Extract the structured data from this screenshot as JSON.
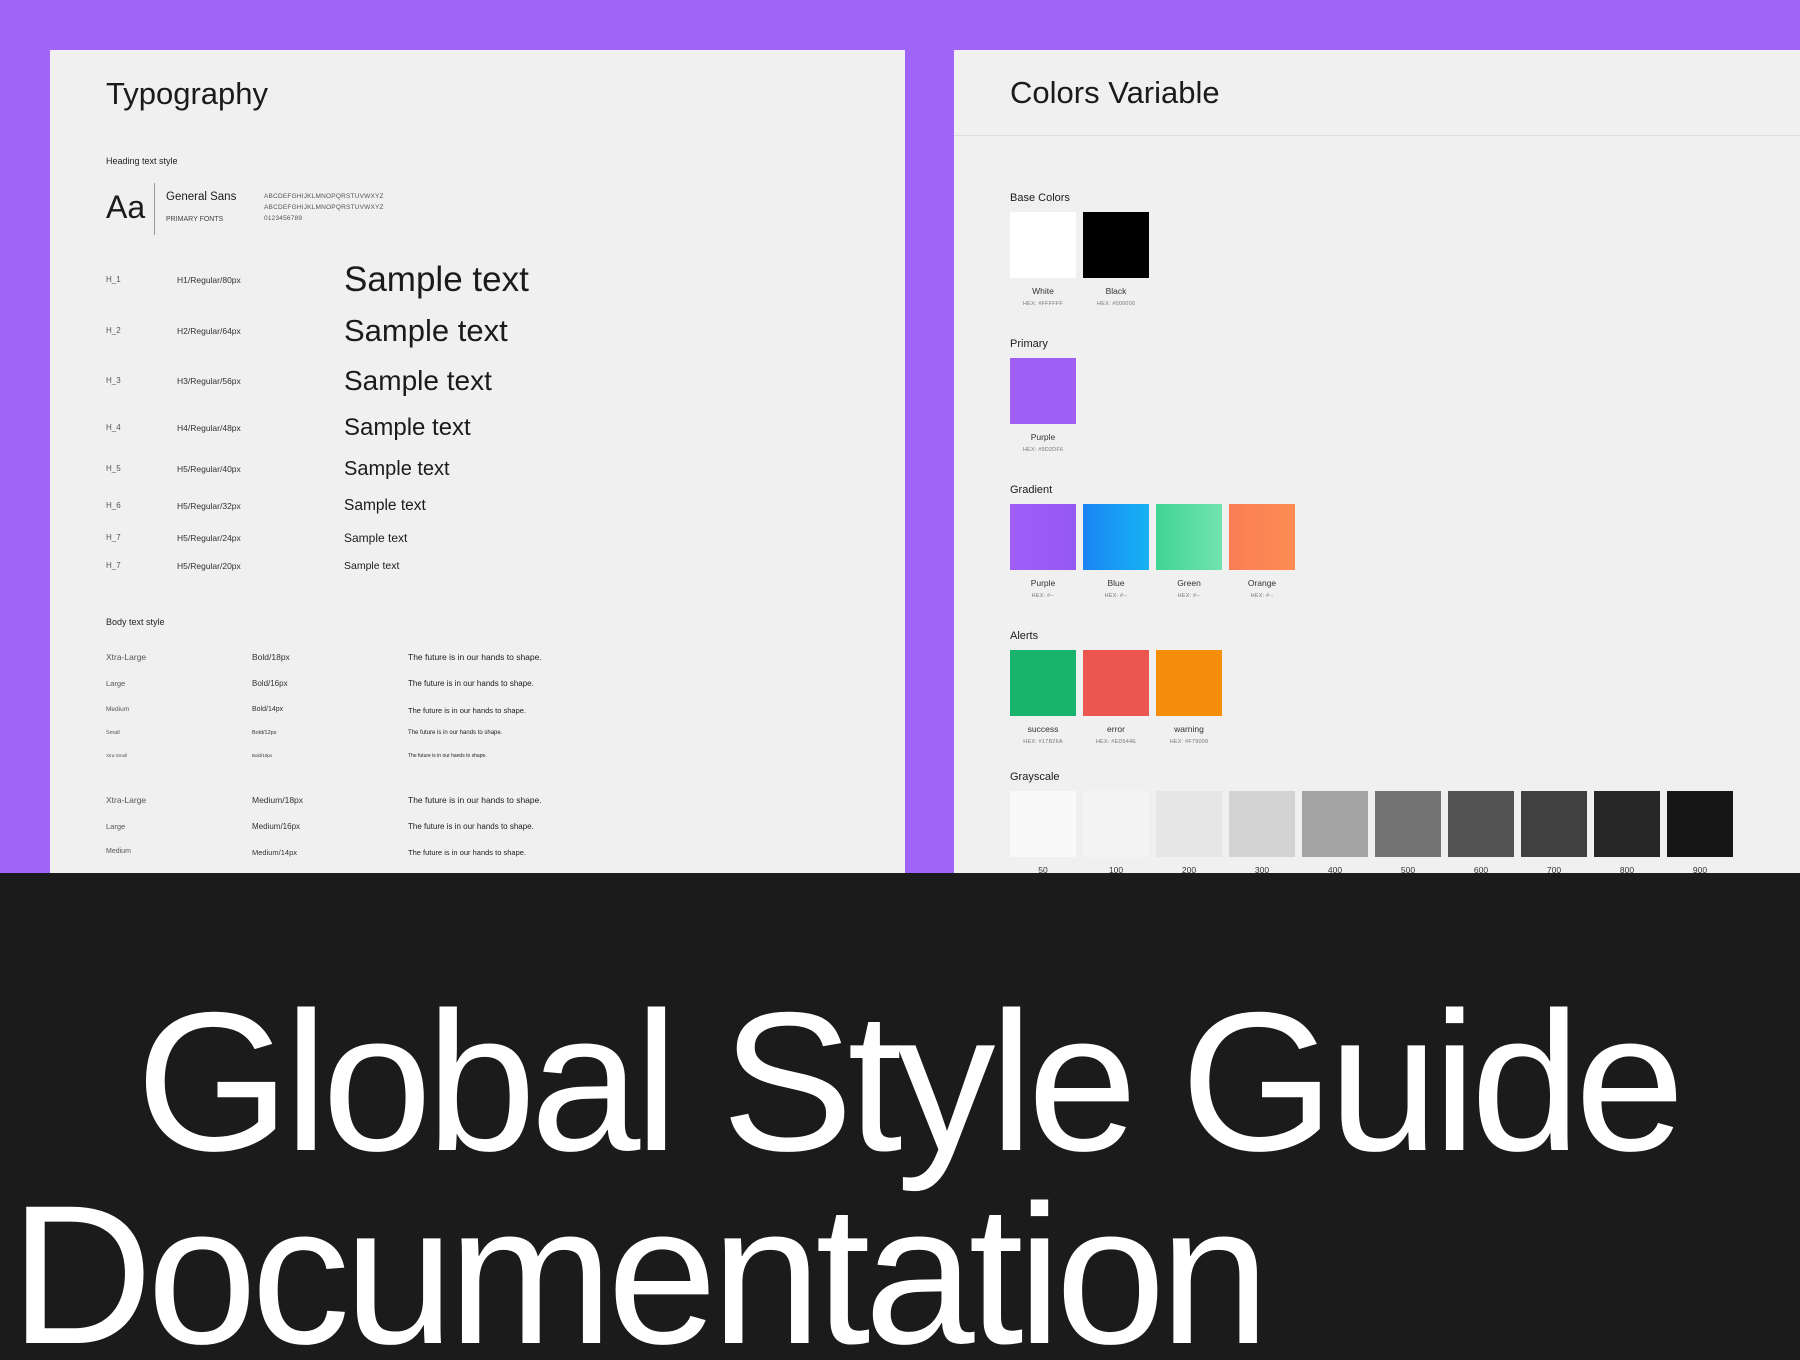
{
  "typography": {
    "title": "Typography",
    "heading_section_label": "Heading text style",
    "font_specimen": "Aa",
    "font_name": "General Sans",
    "font_role": "PRIMARY FONTS",
    "alphabet_upper": "ABCDEFGHIJKLMNOPQRSTUVWXYZ",
    "alphabet_lower": "ABCDEFGHIJKLMNOPQRSTUVWXYZ",
    "digits": "0123456789",
    "headings": [
      {
        "id": "H_1",
        "spec": "H1/Regular/80px",
        "sample": "Sample text"
      },
      {
        "id": "H_2",
        "spec": "H2/Regular/64px",
        "sample": "Sample text"
      },
      {
        "id": "H_3",
        "spec": "H3/Regular/56px",
        "sample": "Sample text"
      },
      {
        "id": "H_4",
        "spec": "H4/Regular/48px",
        "sample": "Sample text"
      },
      {
        "id": "H_5",
        "spec": "H5/Regular/40px",
        "sample": "Sample text"
      },
      {
        "id": "H_6",
        "spec": "H5/Regular/32px",
        "sample": "Sample text"
      },
      {
        "id": "H_7",
        "spec": "H5/Regular/24px",
        "sample": "Sample text"
      },
      {
        "id": "H_7",
        "spec": "H5/Regular/20px",
        "sample": "Sample text"
      }
    ],
    "body_section_label": "Body text style",
    "body_bold": [
      {
        "size": "Xtra-Large",
        "spec": "Bold/18px",
        "sample": "The future is in our hands to shape."
      },
      {
        "size": "Large",
        "spec": "Bold/16px",
        "sample": "The future is in our hands to shape."
      },
      {
        "size": "Medium",
        "spec": "Bold/14px",
        "sample": "The future is in our hands to shape."
      },
      {
        "size": "Small",
        "spec": "Bold/12px",
        "sample": "The future is in our hands to shape."
      },
      {
        "size": "Xtra-Small",
        "spec": "Bold/10px",
        "sample": "The future is in our hands to shape."
      }
    ],
    "body_medium": [
      {
        "size": "Xtra-Large",
        "spec": "Medium/18px",
        "sample": "The future is in our hands to shape."
      },
      {
        "size": "Large",
        "spec": "Medium/16px",
        "sample": "The future is in our hands to shape."
      },
      {
        "size": "Medium",
        "spec": "Medium/14px",
        "sample": "The future is in our hands to shape."
      }
    ]
  },
  "colors": {
    "title": "Colors Variable",
    "base": {
      "label": "Base Colors",
      "swatches": [
        {
          "name": "White",
          "hex": "HEX: #FFFFFF",
          "color": "#ffffff"
        },
        {
          "name": "Black",
          "hex": "HEX: #000000",
          "color": "#000000"
        }
      ]
    },
    "primary": {
      "label": "Primary",
      "swatches": [
        {
          "name": "Purple",
          "hex": "HEX: #9D2DF6",
          "color": "#a160f5"
        }
      ]
    },
    "gradient": {
      "label": "Gradient",
      "swatches": [
        {
          "name": "Purple",
          "hex": "HEX: #--",
          "from": "#a05ef7",
          "to": "#9558f2"
        },
        {
          "name": "Blue",
          "hex": "HEX: #--",
          "from": "#1a84f5",
          "to": "#16b2f3"
        },
        {
          "name": "Green",
          "hex": "HEX: #--",
          "from": "#3fd493",
          "to": "#72e2b0"
        },
        {
          "name": "Orange",
          "hex": "HEX: #--",
          "from": "#fa7e55",
          "to": "#fd8c52"
        }
      ]
    },
    "alerts": {
      "label": "Alerts",
      "swatches": [
        {
          "name": "success",
          "hex": "HEX: #17B26A",
          "color": "#18b46b"
        },
        {
          "name": "error",
          "hex": "HEX: #ED544E",
          "color": "#ec5550"
        },
        {
          "name": "warning",
          "hex": "HEX: #F79009",
          "color": "#f68e0c"
        }
      ]
    },
    "grayscale": {
      "label": "Grayscale",
      "swatches": [
        {
          "name": "50",
          "color": "#f9f9f9"
        },
        {
          "name": "100",
          "color": "#f4f4f4"
        },
        {
          "name": "200",
          "color": "#e6e6e6"
        },
        {
          "name": "300",
          "color": "#d3d3d3"
        },
        {
          "name": "400",
          "color": "#a3a3a3"
        },
        {
          "name": "500",
          "color": "#737373"
        },
        {
          "name": "600",
          "color": "#535353"
        },
        {
          "name": "700",
          "color": "#404040"
        },
        {
          "name": "800",
          "color": "#262626"
        },
        {
          "name": "900",
          "color": "#171717"
        }
      ]
    }
  },
  "headline": {
    "line1": "Global Style Guide",
    "line2": "Documentation"
  },
  "theme": {
    "accent": "#a065f6",
    "panel_bg": "#f0f0f0",
    "dark_bg": "#1b1b1b"
  }
}
